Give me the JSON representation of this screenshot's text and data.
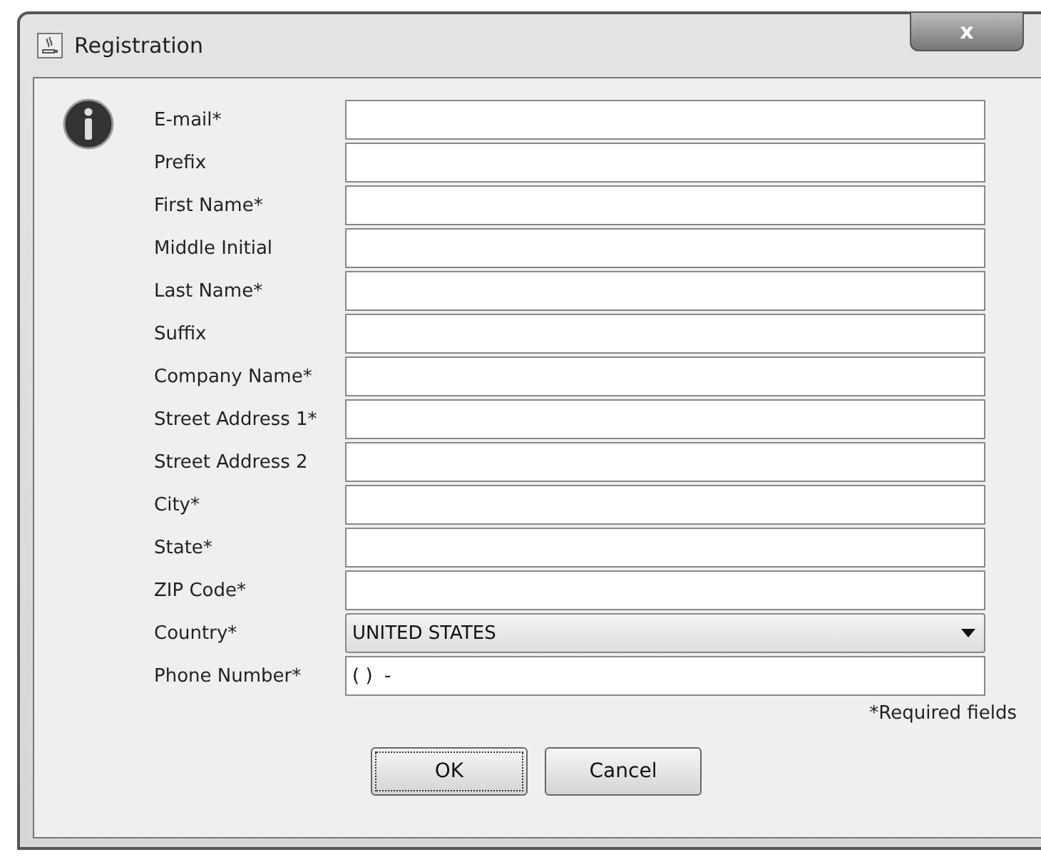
{
  "window": {
    "title": "Registration",
    "close": "x"
  },
  "fields": [
    {
      "label": "E-mail*",
      "kind": "text"
    },
    {
      "label": "Prefix",
      "kind": "text"
    },
    {
      "label": "First Name*",
      "kind": "text"
    },
    {
      "label": "Middle Initial",
      "kind": "text"
    },
    {
      "label": "Last Name*",
      "kind": "text"
    },
    {
      "label": "Suffix",
      "kind": "text"
    },
    {
      "label": "Company Name*",
      "kind": "text"
    },
    {
      "label": "Street Address 1*",
      "kind": "text"
    },
    {
      "label": "Street Address 2",
      "kind": "text"
    },
    {
      "label": "City*",
      "kind": "text"
    },
    {
      "label": "State*",
      "kind": "text"
    },
    {
      "label": "ZIP Code*",
      "kind": "text"
    },
    {
      "label": "Country*",
      "kind": "select",
      "value": "UNITED STATES"
    },
    {
      "label": "Phone Number*",
      "kind": "text",
      "value": "( )  -"
    }
  ],
  "note": "*Required fields",
  "buttons": [
    {
      "label": "OK",
      "focused": true
    },
    {
      "label": "Cancel",
      "focused": false
    }
  ]
}
